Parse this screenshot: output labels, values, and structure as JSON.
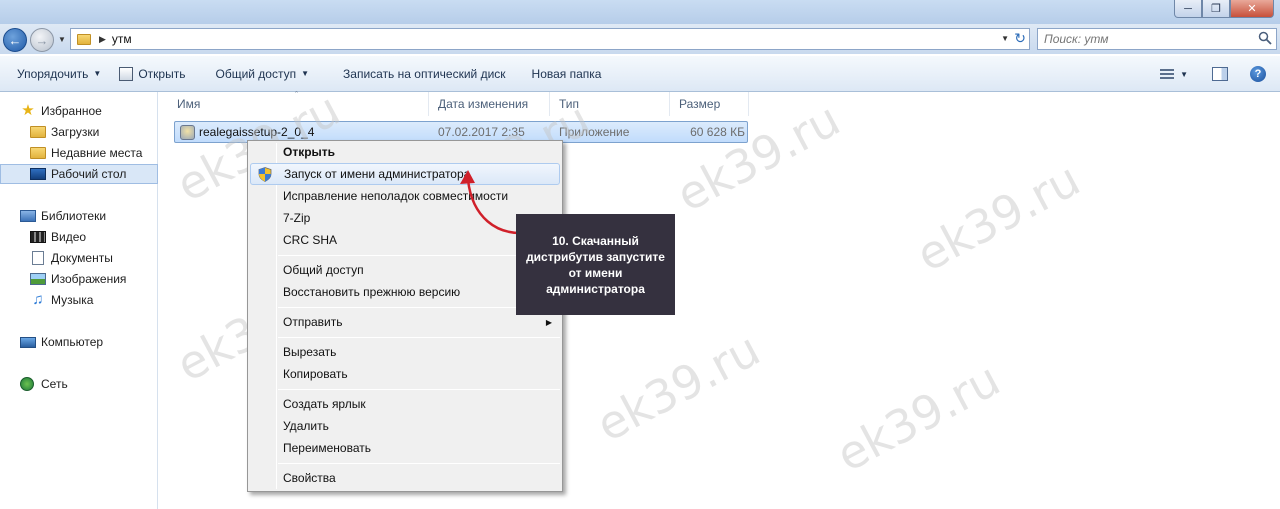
{
  "addressbar": {
    "path": "утм",
    "search_placeholder": "Поиск: утм"
  },
  "toolbar": {
    "organize": "Упорядочить",
    "open": "Открыть",
    "share": "Общий доступ",
    "burn": "Записать на оптический диск",
    "new_folder": "Новая папка"
  },
  "navpane": {
    "favorites": "Избранное",
    "downloads": "Загрузки",
    "recent": "Недавние места",
    "desktop": "Рабочий стол",
    "libraries": "Библиотеки",
    "video": "Видео",
    "documents": "Документы",
    "images": "Изображения",
    "music": "Музыка",
    "computer": "Компьютер",
    "network": "Сеть"
  },
  "columns": {
    "name": "Имя",
    "date": "Дата изменения",
    "type": "Тип",
    "size": "Размер"
  },
  "file": {
    "name": "realegaissetup-2_0_4",
    "date": "07.02.2017 2:35",
    "type": "Приложение",
    "size": "60 628 КБ"
  },
  "context_menu": {
    "open": "Открыть",
    "run_as_admin": "Запуск от имени администратора",
    "troubleshoot": "Исправление неполадок совместимости",
    "zip": "7-Zip",
    "crc": "CRC SHA",
    "share": "Общий доступ",
    "restore": "Восстановить прежнюю версию",
    "send_to": "Отправить",
    "cut": "Вырезать",
    "copy": "Копировать",
    "shortcut": "Создать ярлык",
    "delete": "Удалить",
    "rename": "Переименовать",
    "properties": "Свойства"
  },
  "annotation": {
    "text": "10. Скачанный дистрибутив запустите от имени администратора",
    "bg_color": "#35313f",
    "arrow_color": "#d0202a"
  },
  "watermark": {
    "text": "ek39.ru"
  }
}
